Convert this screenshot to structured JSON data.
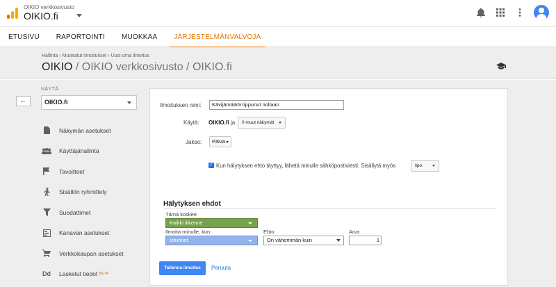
{
  "topbar": {
    "account_sub": "OIKIO verkkosivusto",
    "account_main": "OIKIO.fi",
    "icons": [
      "notifications-icon",
      "apps-grid-icon",
      "more-vert-icon",
      "account-avatar"
    ]
  },
  "nav": {
    "tabs": [
      {
        "label": "ETUSIVU",
        "active": false
      },
      {
        "label": "RAPORTOINTI",
        "active": false
      },
      {
        "label": "MUOKKAA",
        "active": false
      },
      {
        "label": "JÄRJESTELMÄNVALVOJA",
        "active": true
      }
    ],
    "accent_color": "#e37400"
  },
  "header": {
    "breadcrumb": "Hallinta › Muokatut ilmoitukset › Uusi oma ilmoitus",
    "title_main": "OIKIO",
    "title_sub": " / OIKIO verkkosivusto / OIKIO.fi"
  },
  "sidebar": {
    "view_label": "NÄYTÄ",
    "view_selected": "OIKIO.fi",
    "items": [
      {
        "label": "Näkymän asetukset",
        "icon": "document-icon"
      },
      {
        "label": "Käyttäjähallinta",
        "icon": "people-icon"
      },
      {
        "label": "Tavoitteet",
        "icon": "flag-icon"
      },
      {
        "label": "Sisällön ryhmittely",
        "icon": "person-walking-icon"
      },
      {
        "label": "Suodattimet",
        "icon": "filter-icon"
      },
      {
        "label": "Kanavan asetukset",
        "icon": "channel-icon"
      },
      {
        "label": "Verkkokaupan asetukset",
        "icon": "cart-icon"
      },
      {
        "label": "Lasketut tiedot",
        "icon": "dd-icon",
        "badge": "BETA"
      }
    ]
  },
  "form": {
    "name_label": "Ilmoituksen nimi:",
    "name_value": "Kävijämäärä tippunut nollaan",
    "use_label": "Käytä:",
    "use_value": "OIKIO.fi",
    "use_and": "ja",
    "other_views": "0 muut näkymät",
    "period_label": "Jakso:",
    "period_value": "Päivä",
    "email_checkbox_text": "Kun hälytyksen ehto täyttyy, lähetä minulle sähköpostiviesti. Sisällytä myös",
    "email_checkbox_checked": true,
    "include_select": "lipo",
    "conditions_title": "Hälytyksen ehdot",
    "applies_label": "Tämä koskee",
    "applies_value": "Kaikki liikenne",
    "notify_label": "Ilmoita minulle, kun",
    "notify_value": "Istunnot",
    "condition_label": "Ehto",
    "condition_value": "On vähemmän kuin",
    "value_label": "Arvo",
    "value_value": "1",
    "save_label": "Tallenna ilmoitus",
    "cancel_label": "Peruuta"
  }
}
